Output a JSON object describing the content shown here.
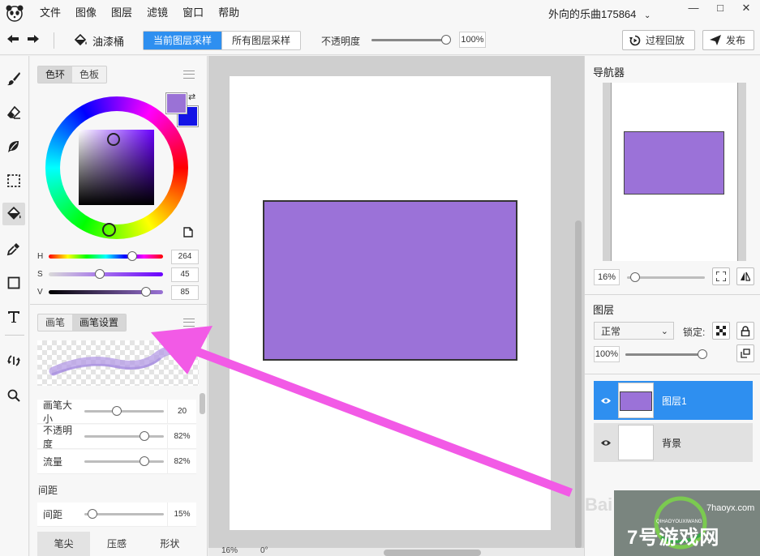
{
  "app": {
    "menu": [
      "文件",
      "图像",
      "图层",
      "滤镜",
      "窗口",
      "帮助"
    ],
    "doc_title": "外向的乐曲175864",
    "window_controls": {
      "minimize": "—",
      "maximize": "□",
      "close": "✕"
    }
  },
  "toolbar": {
    "tool_name": "油漆桶",
    "sample_options": [
      "当前图层采样",
      "所有图层采样"
    ],
    "sample_selected": "当前图层采样",
    "opacity_label": "不透明度",
    "opacity_value": "100%",
    "opacity_fraction": 1.0,
    "history_label": "过程回放",
    "publish_label": "发布"
  },
  "tools": [
    {
      "icon": "brush-icon"
    },
    {
      "icon": "eraser-icon"
    },
    {
      "icon": "smudge-icon"
    },
    {
      "icon": "marquee-icon"
    },
    {
      "icon": "bucket-icon",
      "active": true
    },
    {
      "icon": "eyedropper-icon"
    },
    {
      "icon": "rectangle-icon"
    },
    {
      "icon": "text-icon"
    },
    {
      "icon": "transform-icon"
    },
    {
      "icon": "zoom-icon"
    }
  ],
  "color_panel": {
    "tabs": [
      "色环",
      "色板"
    ],
    "active_tab": "色环",
    "foreground": "#9a72d6",
    "background": "#1414e6",
    "h_label": "H",
    "h_value": "264",
    "s_label": "S",
    "s_value": "45",
    "v_label": "V",
    "v_value": "85",
    "h_fraction": 0.733,
    "s_fraction": 0.45,
    "v_fraction": 0.85
  },
  "brush_panel": {
    "tabs": [
      "画笔",
      "画笔设置"
    ],
    "active_tab": "画笔设置",
    "settings": [
      {
        "label": "画笔大小",
        "value": "20",
        "fraction": 0.41
      },
      {
        "label": "不透明度",
        "value": "82%",
        "fraction": 0.76
      },
      {
        "label": "流量",
        "value": "82%",
        "fraction": 0.76
      }
    ],
    "spacing_heading": "间距",
    "spacing": {
      "label": "间距",
      "value": "15%",
      "fraction": 0.1
    },
    "bottom_tabs": [
      "笔尖",
      "压感",
      "形状"
    ],
    "bottom_active": "笔尖"
  },
  "canvas": {
    "shape_fill": "#9b72d8",
    "status_zoom": "16%",
    "status_angle": "0°"
  },
  "navigator": {
    "title": "导航器",
    "zoom": "16%"
  },
  "layers": {
    "title": "图层",
    "blend_mode": "正常",
    "lock_label": "锁定:",
    "opacity": "100%",
    "items": [
      {
        "name": "图层1",
        "selected": true
      },
      {
        "name": "背景",
        "selected": false
      }
    ]
  },
  "watermark": {
    "baidu": "Bai",
    "site": "7号游戏网",
    "url": "7haoyx.com",
    "pinyin": "QIHAOYOUXIWANG"
  },
  "colors": {
    "accent": "#2e8ff0",
    "annotation_arrow": "#f25ae6",
    "shape": "#9b72d8"
  }
}
